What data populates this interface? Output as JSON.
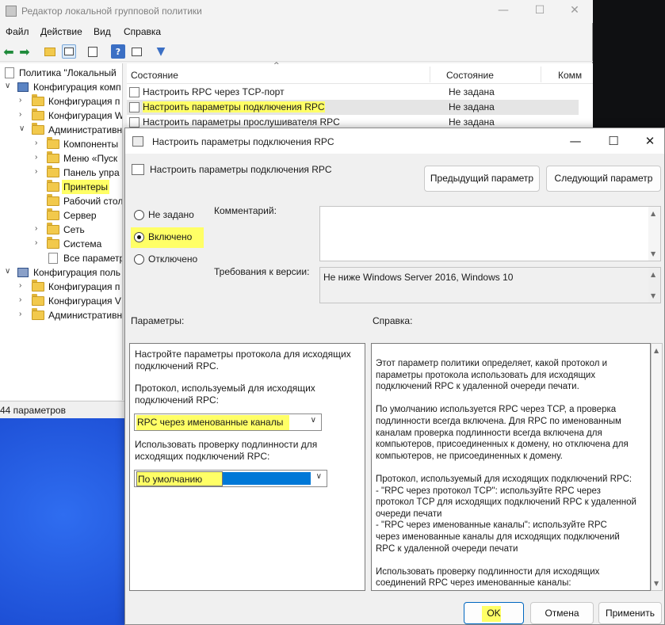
{
  "main_window": {
    "title": "Редактор локальной групповой политики",
    "controls": {
      "minimize": "—",
      "maximize": "☐",
      "close": "✕"
    }
  },
  "menu": [
    "Файл",
    "Действие",
    "Вид",
    "Справка"
  ],
  "toolbar": {
    "icons": [
      "back-icon",
      "forward-icon",
      "folder-up-icon",
      "show-hide-tree-icon",
      "export-icon",
      "help-icon",
      "properties-icon",
      "filter-icon"
    ]
  },
  "tree": {
    "items": [
      {
        "label": "Политика \"Локальный",
        "level": 0
      },
      {
        "label": "Конфигурация комп",
        "level": 1
      },
      {
        "label": "Конфигурация п",
        "level": 2
      },
      {
        "label": "Конфигурация W",
        "level": 2
      },
      {
        "label": "Административн",
        "level": 2
      },
      {
        "label": "Компоненты",
        "level": 3
      },
      {
        "label": "Меню «Пуск",
        "level": 3
      },
      {
        "label": "Панель упра",
        "level": 3
      },
      {
        "label": "Принтеры",
        "level": 3,
        "selected": true
      },
      {
        "label": "Рабочий стол",
        "level": 3
      },
      {
        "label": "Сервер",
        "level": 3
      },
      {
        "label": "Сеть",
        "level": 3
      },
      {
        "label": "Система",
        "level": 3
      },
      {
        "label": "Все параметр",
        "level": 3
      },
      {
        "label": "Конфигурация поль",
        "level": 1
      },
      {
        "label": "Конфигурация п",
        "level": 2
      },
      {
        "label": "Конфигурация V",
        "level": 2
      },
      {
        "label": "Административн",
        "level": 2
      }
    ]
  },
  "status_bar": {
    "text": "44 параметров"
  },
  "list": {
    "columns": [
      "Состояние",
      "Состояние",
      "Комм"
    ],
    "rows": [
      {
        "name": "Настроить RPC через TCP-порт",
        "state": "Не задана"
      },
      {
        "name": "Настроить параметры подключения RPC",
        "state": "Не задана",
        "selected": true
      },
      {
        "name": "Настроить параметры прослушивателя RPC",
        "state": "Не задана"
      }
    ]
  },
  "dialog": {
    "title": "Настроить параметры подключения RPC",
    "subtitle": "Настроить параметры подключения RPC",
    "prev_button": "Предыдущий параметр",
    "next_button": "Следующий параметр",
    "radio": {
      "not_configured": "Не задано",
      "enabled": "Включено",
      "disabled": "Отключено",
      "selected": "enabled"
    },
    "comment_label": "Комментарий:",
    "comment_value": "",
    "requirements_label": "Требования к версии:",
    "requirements_value": "Не ниже Windows Server 2016, Windows 10",
    "params_label": "Параметры:",
    "help_label": "Справка:",
    "params": {
      "intro": "Настройте параметры протокола для исходящих\nподключений RPC.",
      "protocol_label": "Протокол, используемый для исходящих\nподключений RPC:",
      "protocol_value": "RPC через именованные каналы",
      "auth_label": "Использовать проверку подлинности для\nисходящих подключений RPC:",
      "auth_value": "По умолчанию"
    },
    "help": {
      "text": "Этот параметр политики определяет, какой протокол и\nпараметры протокола использовать для исходящих\nподключений RPC к удаленной очереди печати.\n\nПо умолчанию используется RPC через TCP, а проверка\nподлинности всегда включена. Для RPC по именованным\nканалам проверка подлинности всегда включена для\nкомпьютеров, присоединенных к домену, но отключена для\nкомпьютеров, не присоединенных к домену.\n\nПротокол, используемый для исходящих подключений RPC:\n   - \"RPC через протокол TCP\": используйте RPC через\nпротокол TCP для исходящих подключений RPC к удаленной\nочереди печати\n   - \"RPC через именованные каналы\": используйте RPC\nчерез именованные каналы для исходящих подключений\nRPC к удаленной очереди печати\n\nИспользовать проверку подлинности для исходящих\nсоединений RPC через именованные каналы:"
    },
    "ok_button": "OK",
    "cancel_button": "Отмена",
    "apply_button": "Применить"
  },
  "colors": {
    "highlight": "#ffff66",
    "selection_blue": "#0078d7",
    "tree_selected": "#cce4f7"
  }
}
